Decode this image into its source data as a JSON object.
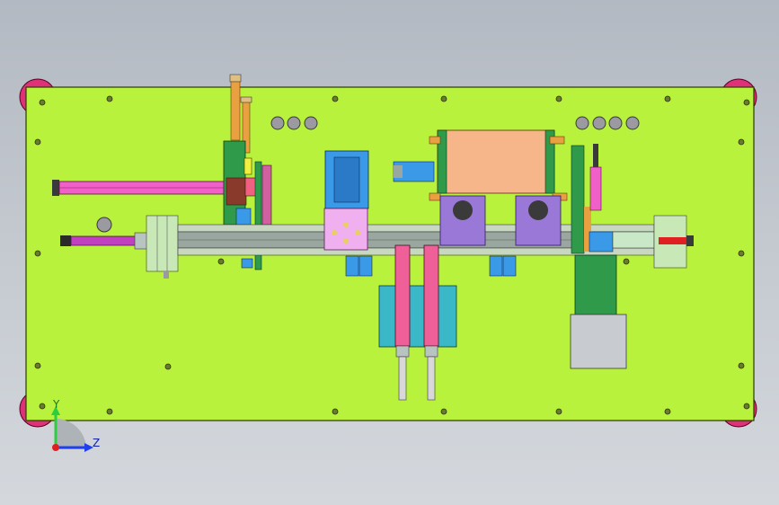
{
  "view": {
    "background_top": "#b3b9c2",
    "background_bottom": "#d4d8dd"
  },
  "colors": {
    "baseplate": "#b8f23c",
    "baseplate_edge": "#2a3a00",
    "feet": "#e0307a",
    "cylinder_magenta": "#f060c8",
    "rod_orange": "#e8a040",
    "sensor_blue": "#3a9ae8",
    "block_pink": "#f0b0f0",
    "block_salmon": "#f6b68a",
    "block_violet": "#9a78d8",
    "block_green": "#2e9a4a",
    "rail_gray": "#9aa6a0",
    "holes_gray": "#9a9aa0",
    "dark_gray": "#3a3a3a"
  },
  "triad": {
    "y_label": "Y",
    "z_label": "Z",
    "y_color": "#2ecc40",
    "z_color": "#2040f0",
    "x_color": "#e02020"
  }
}
